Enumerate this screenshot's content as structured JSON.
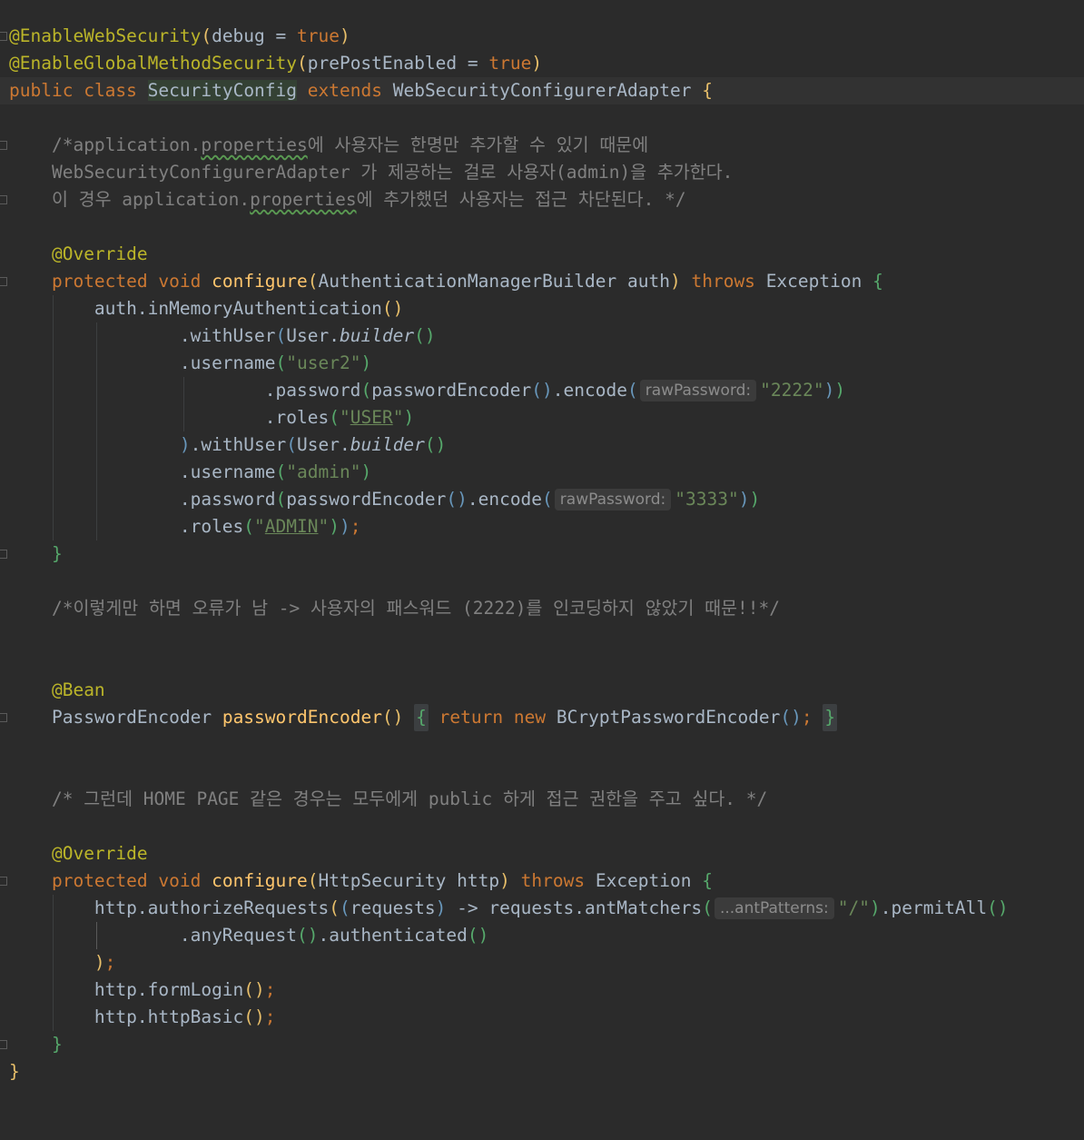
{
  "editor": {
    "language": "Java",
    "annotations": {
      "enable_web_security": "@EnableWebSecurity",
      "enable_global_method_security": "@EnableGlobalMethodSecurity",
      "override": "@Override",
      "bean": "@Bean"
    },
    "keywords": {
      "public": "public",
      "class": "class",
      "extends": "extends",
      "protected": "protected",
      "void": "void",
      "throws": "throws",
      "return": "return",
      "new": "new",
      "true": "true"
    },
    "identifiers": {
      "debug": "debug",
      "pre_post_enabled": "prePostEnabled",
      "class_name": "SecurityConfig",
      "super_class": "WebSecurityConfigurerAdapter",
      "configure": "configure",
      "auth_type": "AuthenticationManagerBuilder",
      "auth": "auth",
      "exception": "Exception",
      "in_memory": ".inMemoryAuthentication",
      "with_user": ".withUser",
      "user": "User",
      "builder": "builder",
      "username": ".username",
      "password": ".password",
      "password_encoder": "passwordEncoder",
      "encode": ".encode",
      "roles": ".roles",
      "password_encoder_type": "PasswordEncoder",
      "bcrypt": "BCryptPasswordEncoder",
      "http_security": "HttpSecurity",
      "http": "http",
      "authorize_requests": ".authorizeRequests",
      "requests": "requests",
      "arrow": "->",
      "ant_matchers": ".antMatchers",
      "permit_all": ".permitAll",
      "any_request": ".anyRequest",
      "authenticated": ".authenticated",
      "form_login": ".formLogin",
      "http_basic": ".httpBasic"
    },
    "strings": {
      "user2": "\"user2\"",
      "pw_2222": "\"2222\"",
      "role_user_open": "\"",
      "role_user": "USER",
      "role_close": "\"",
      "admin": "\"admin\"",
      "pw_3333": "\"3333\"",
      "role_admin": "ADMIN",
      "root_path": "\"/\""
    },
    "hints": {
      "raw_password": "rawPassword:",
      "ant_patterns": "...antPatterns:"
    },
    "comments": {
      "c1_a": "/*application.",
      "c1_b": "properties",
      "c1_c": "에 사용자는 한명만 추가할 수 있기 때문에",
      "c2": "WebSecurityConfigurerAdapter 가 제공하는 걸로 사용자(admin)을 추가한다.",
      "c3_a": "이 경우 application.",
      "c3_b": "properties",
      "c3_c": "에 추가했던 사용자는 접근 차단된다. */",
      "c4": "/*이렇게만 하면 오류가 남 -> 사용자의 패스워드 (2222)를 인코딩하지 않았기 때문!!*/",
      "c5": "/* 그런데 HOME PAGE 같은 경우는 모두에게 public 하게 접근 권한을 주고 싶다. */"
    },
    "colors": {
      "background": "#2b2b2b",
      "keyword": "#cc7832",
      "annotation": "#bbb529",
      "string": "#6a8759",
      "comment": "#808080",
      "method": "#ffc66d"
    }
  }
}
